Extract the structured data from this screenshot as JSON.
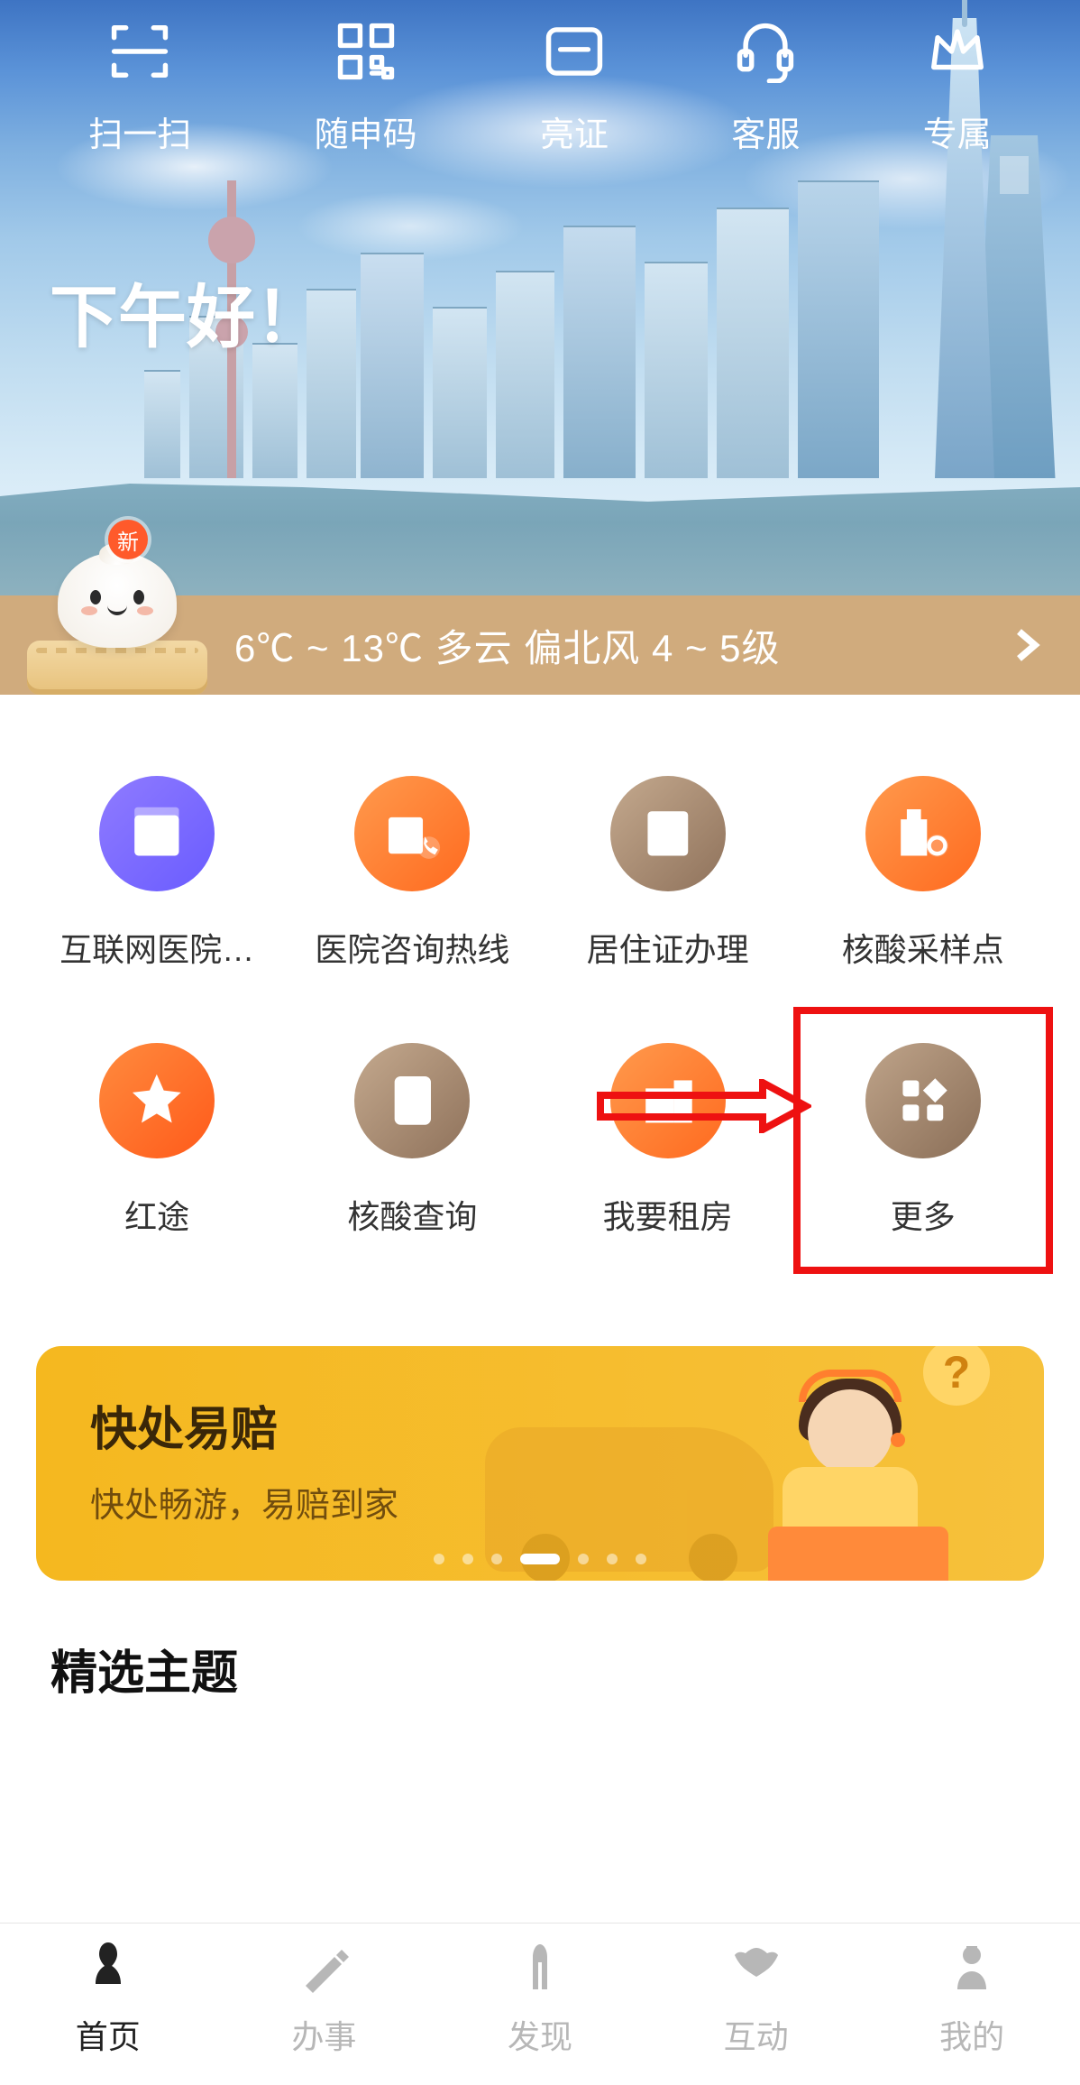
{
  "top_shortcuts": [
    {
      "icon": "scan-icon",
      "label": "扫一扫"
    },
    {
      "icon": "qrcode-icon",
      "label": "随申码"
    },
    {
      "icon": "idcard-icon",
      "label": "亮证"
    },
    {
      "icon": "support-icon",
      "label": "客服"
    },
    {
      "icon": "crown-icon",
      "label": "专属"
    }
  ],
  "greeting": "下午好！",
  "mascot_badge": "新",
  "weather_text": "6℃ ~ 13℃  多云  偏北风  4 ~ 5级",
  "services": [
    {
      "icon": "hospital-icon",
      "label": "互联网医院…",
      "color": "c-purple"
    },
    {
      "icon": "hotline-icon",
      "label": "医院咨询热线",
      "color": "c-orange"
    },
    {
      "icon": "residence-icon",
      "label": "居住证办理",
      "color": "c-brown"
    },
    {
      "icon": "nucleic-site-icon",
      "label": "核酸采样点",
      "color": "c-orange"
    },
    {
      "icon": "hongtu-icon",
      "label": "红途",
      "color": "c-orange2"
    },
    {
      "icon": "nucleic-query-icon",
      "label": "核酸查询",
      "color": "c-brown"
    },
    {
      "icon": "rent-icon",
      "label": "我要租房",
      "color": "c-orange"
    },
    {
      "icon": "more-icon",
      "label": "更多",
      "color": "c-brown2",
      "highlighted": true
    }
  ],
  "promo": {
    "title": "快处易赔",
    "subtitle": "快处畅游，易赔到家",
    "question_mark": "?"
  },
  "section_title": "精选主题",
  "tabs": [
    {
      "icon": "home-tab-icon",
      "label": "首页",
      "active": true
    },
    {
      "icon": "service-tab-icon",
      "label": "办事",
      "active": false
    },
    {
      "icon": "discover-tab-icon",
      "label": "发现",
      "active": false
    },
    {
      "icon": "interact-tab-icon",
      "label": "互动",
      "active": false
    },
    {
      "icon": "mine-tab-icon",
      "label": "我的",
      "active": false
    }
  ]
}
